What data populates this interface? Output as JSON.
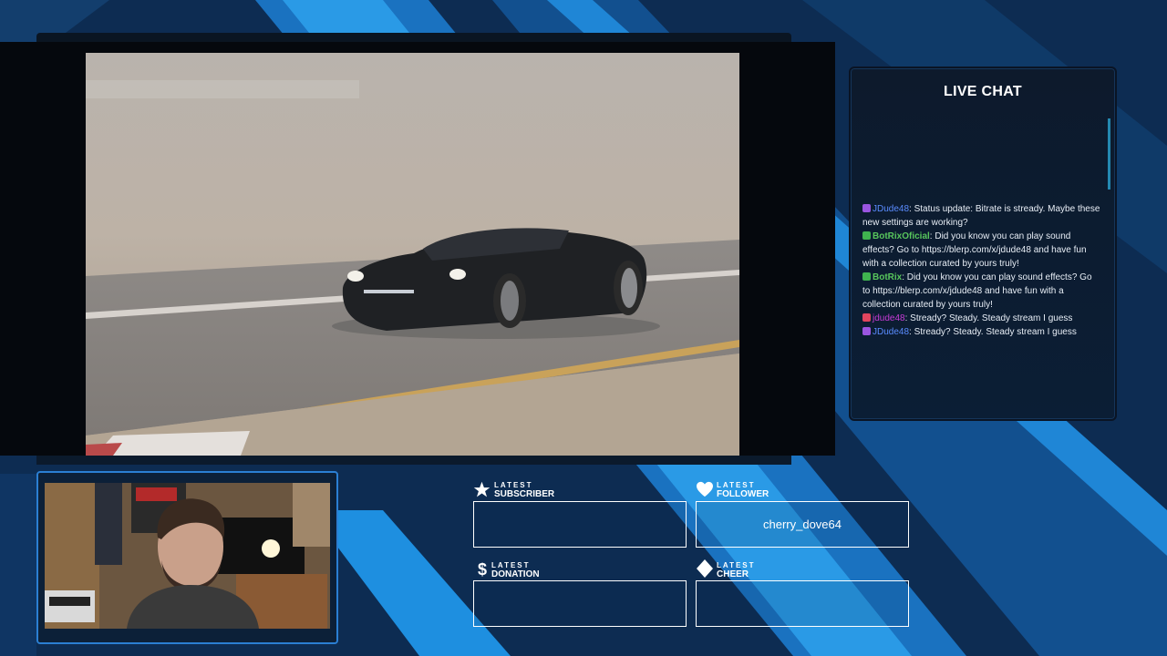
{
  "chat": {
    "title": "LIVE CHAT",
    "messages": [
      {
        "user": "JDude48",
        "color": "blue",
        "text": ": Status update: Bitrate is stready. Maybe these new settings are working?"
      },
      {
        "user": "BotRixOficial",
        "color": "green",
        "text": ": Did you know you can play sound effects? Go to https://blerp.com/x/jdude48 and have fun with a collection curated by yours truly!"
      },
      {
        "user": "BotRix",
        "color": "green",
        "text": ": Did you know you can play sound effects? Go to https://blerp.com/x/jdude48 and have fun with a collection curated by yours truly!"
      },
      {
        "user": "jdude48",
        "color": "pink",
        "text": ": Stready? Steady. Steady stream I guess"
      },
      {
        "user": "JDude48",
        "color": "blue",
        "text": ": Stready? Steady. Steady stream I guess"
      }
    ]
  },
  "widgets": {
    "subscriber": {
      "label_small": "LATEST",
      "label_big": "SUBSCRIBER",
      "value": ""
    },
    "follower": {
      "label_small": "LATEST",
      "label_big": "FOLLOWER",
      "value": "cherry_dove64"
    },
    "donation": {
      "label_small": "LATEST",
      "label_big": "DONATION",
      "value": ""
    },
    "cheer": {
      "label_small": "LATEST",
      "label_big": "CHEER",
      "value": ""
    }
  },
  "icons": {
    "subscriber": "star-icon",
    "follower": "heart-icon",
    "donation": "dollar-icon",
    "cheer": "diamond-icon"
  },
  "colors": {
    "accent": "#1e8fe0",
    "background": "#0e2f57",
    "user_blue": "#5a8cff",
    "user_green": "#58c65c",
    "user_pink": "#c73cd6"
  }
}
